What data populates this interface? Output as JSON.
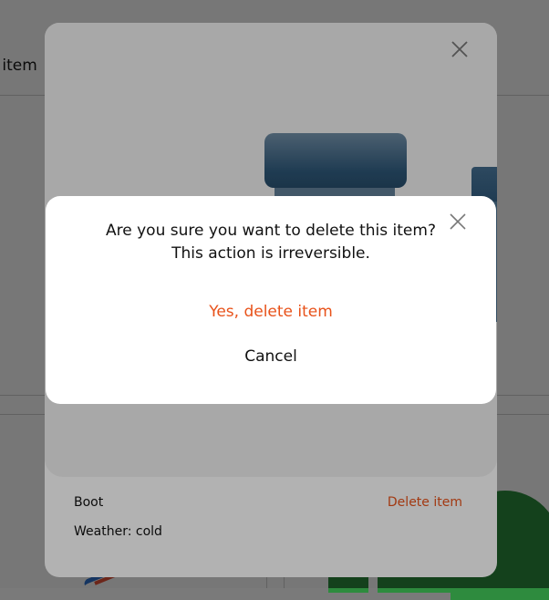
{
  "background": {
    "title_fragment": "r item"
  },
  "item_modal": {
    "name": "Boot",
    "weather": "Weather: cold",
    "delete_label": "Delete item",
    "close_icon": "close-icon",
    "image_icon": "boot-illustration"
  },
  "confirm_dialog": {
    "message_line1": "Are you sure you want to delete this item?",
    "message_line2": "This action is irreversible.",
    "confirm_label": "Yes, delete item",
    "cancel_label": "Cancel",
    "close_icon": "close-icon"
  },
  "colors": {
    "accent": "#e8521a",
    "overlay": "rgba(0,0,0,0.3)",
    "text": "#111111",
    "boot": "#2d5676"
  }
}
